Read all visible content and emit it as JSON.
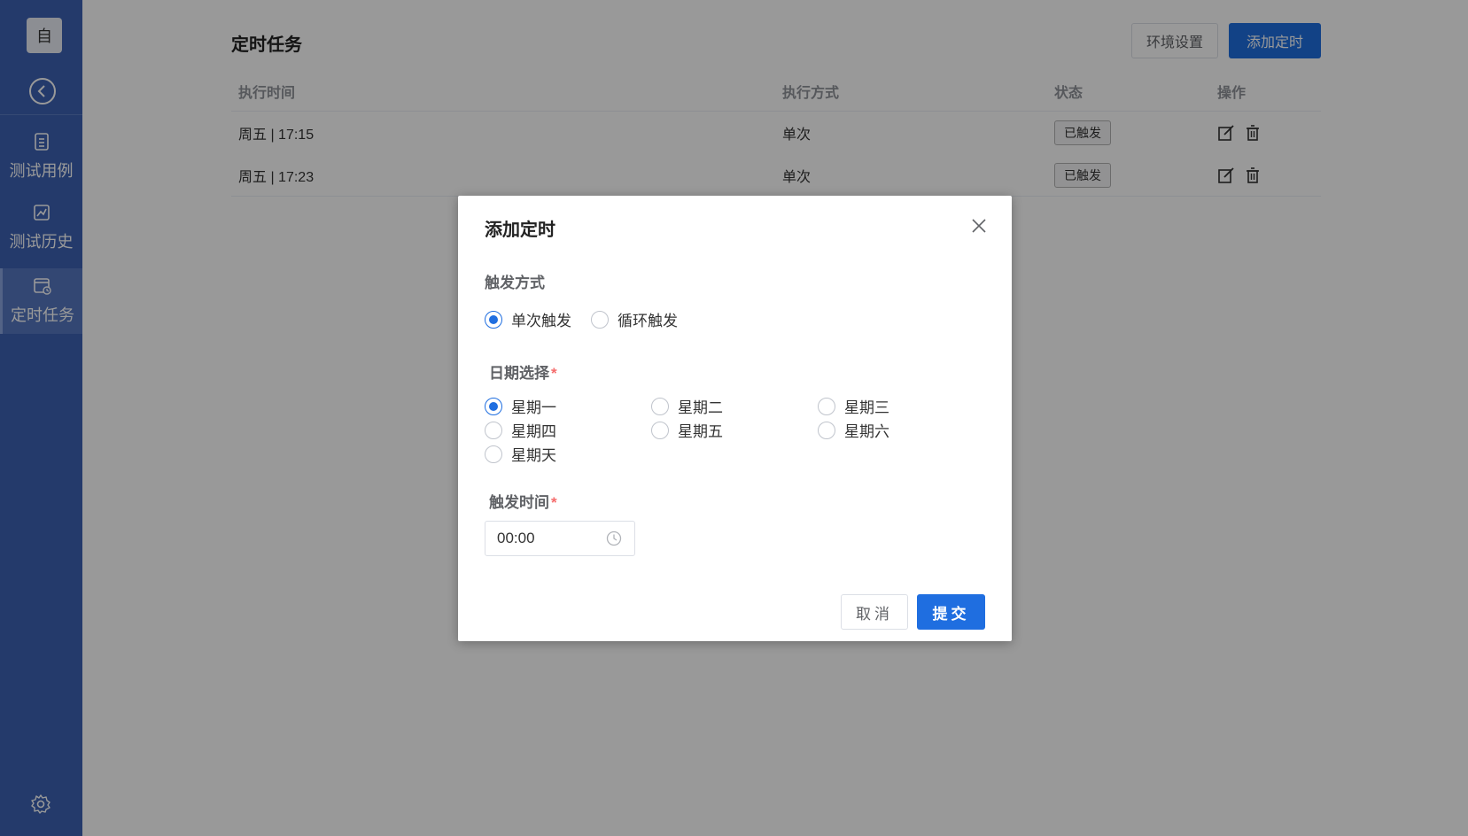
{
  "sidebar": {
    "logo": "自",
    "items": [
      {
        "label": "测试用例",
        "icon": "document-icon"
      },
      {
        "label": "测试历史",
        "icon": "chart-history-icon"
      },
      {
        "label": "定时任务",
        "icon": "calendar-clock-icon"
      }
    ],
    "active": "定时任务"
  },
  "page": {
    "title": "定时任务",
    "env_button": "环境设置",
    "add_button": "添加定时"
  },
  "table": {
    "headers": [
      "执行时间",
      "执行方式",
      "状态",
      "操作"
    ],
    "rows": [
      {
        "time": "周五 | 17:15",
        "mode": "单次",
        "status": "已触发"
      },
      {
        "time": "周五 | 17:23",
        "mode": "单次",
        "status": "已触发"
      }
    ]
  },
  "dialog": {
    "title": "添加定时",
    "trigger_label": "触发方式",
    "trigger_options": [
      "单次触发",
      "循环触发"
    ],
    "trigger_selected": "单次触发",
    "date_label": "日期选择",
    "required_mark": "*",
    "days": [
      "星期一",
      "星期二",
      "星期三",
      "星期四",
      "星期五",
      "星期六",
      "星期天"
    ],
    "day_selected": "星期一",
    "time_label": "触发时间",
    "time_value": "00:00",
    "cancel": "取消",
    "submit": "提交"
  },
  "colors": {
    "sidebar": "#3d62b3",
    "primary": "#1f6ee0",
    "required": "#f56c6c"
  }
}
